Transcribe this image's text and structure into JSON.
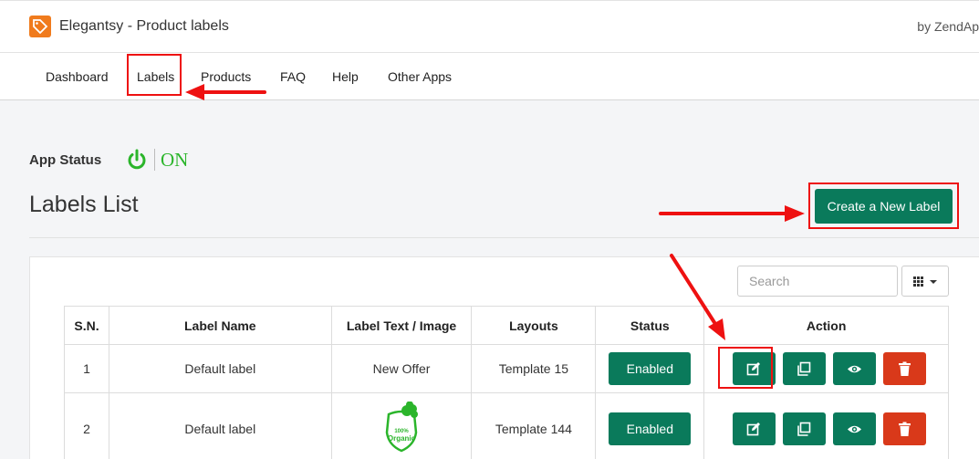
{
  "header": {
    "app_title": "Elegantsy - Product labels",
    "by_text": "by ZendAp",
    "logo_icon": "tag-icon"
  },
  "nav": {
    "items": [
      {
        "label": "Dashboard"
      },
      {
        "label": "Labels"
      },
      {
        "label": "Products"
      },
      {
        "label": "FAQ"
      },
      {
        "label": "Help"
      },
      {
        "label": "Other Apps"
      }
    ],
    "active": "Labels"
  },
  "app_status": {
    "label": "App Status",
    "value": "ON",
    "icon": "power-icon"
  },
  "main": {
    "title": "Labels List",
    "create_button": "Create a New Label",
    "search_placeholder": "Search",
    "columns_icon": "grid-icon"
  },
  "table": {
    "headers": [
      "S.N.",
      "Label Name",
      "Label Text / Image",
      "Layouts",
      "Status",
      "Action"
    ],
    "rows": [
      {
        "sn": "1",
        "name": "Default label",
        "text": "New Offer",
        "layout": "Template 15",
        "status": "Enabled"
      },
      {
        "sn": "2",
        "name": "Default label",
        "text": "",
        "text_image": "100% Organic",
        "layout": "Template 144",
        "status": "Enabled"
      }
    ],
    "action_icons": [
      "edit-icon",
      "copy-icon",
      "eye-icon",
      "trash-icon"
    ]
  },
  "colors": {
    "primary_green": "#0a7a5b",
    "danger_red": "#d9391a",
    "status_on_green": "#2bb52b",
    "logo_orange": "#f07b1d",
    "annotation_red": "#ee1111"
  }
}
